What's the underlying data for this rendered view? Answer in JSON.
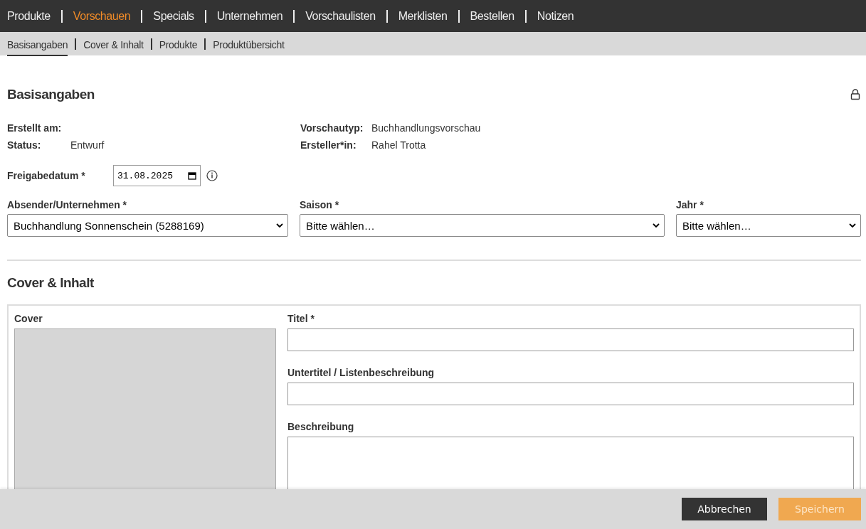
{
  "main_nav": [
    {
      "label": "Produkte",
      "selected": false
    },
    {
      "label": "Vorschauen",
      "selected": true
    },
    {
      "label": "Specials",
      "selected": false
    },
    {
      "label": "Unternehmen",
      "selected": false
    },
    {
      "label": "Vorschaulisten",
      "selected": false
    },
    {
      "label": "Merklisten",
      "selected": false
    },
    {
      "label": "Bestellen",
      "selected": false
    },
    {
      "label": "Notizen",
      "selected": false
    }
  ],
  "sub_nav": [
    {
      "label": "Basisangaben",
      "selected": true
    },
    {
      "label": "Cover & Inhalt",
      "selected": false
    },
    {
      "label": "Produkte",
      "selected": false
    },
    {
      "label": "Produktübersicht",
      "selected": false
    }
  ],
  "basics": {
    "title": "Basisangaben",
    "locked": true,
    "info_left": [
      {
        "label": "Erstellt am:"
      },
      {
        "label": "Status:",
        "value": "Entwurf"
      }
    ],
    "info_right": [
      {
        "label": "Vorschautyp:",
        "value": "Buchhandlungsvorschau"
      },
      {
        "label": "Ersteller*in:",
        "value": "Rahel Trotta"
      }
    ],
    "release_date": {
      "label": "Freigabedatum *",
      "value": "31.08.2025"
    },
    "selects": [
      {
        "label": "Absender/Unternehmen *",
        "value": "Buchhandlung Sonnenschein (5288169)"
      },
      {
        "label": "Saison *",
        "value": "Bitte wählen…"
      },
      {
        "label": "Jahr *",
        "value": "Bitte wählen…"
      }
    ]
  },
  "cover_content": {
    "title": "Cover & Inhalt",
    "cover_label": "Cover",
    "fields": [
      {
        "label": "Titel *",
        "kind": "input"
      },
      {
        "label": "Untertitel / Listenbeschreibung",
        "kind": "input"
      },
      {
        "label": "Beschreibung",
        "kind": "textarea"
      }
    ]
  },
  "footer": {
    "cancel": "Abbrechen",
    "save": {
      "label": "Speichern",
      "disabled": true
    }
  }
}
